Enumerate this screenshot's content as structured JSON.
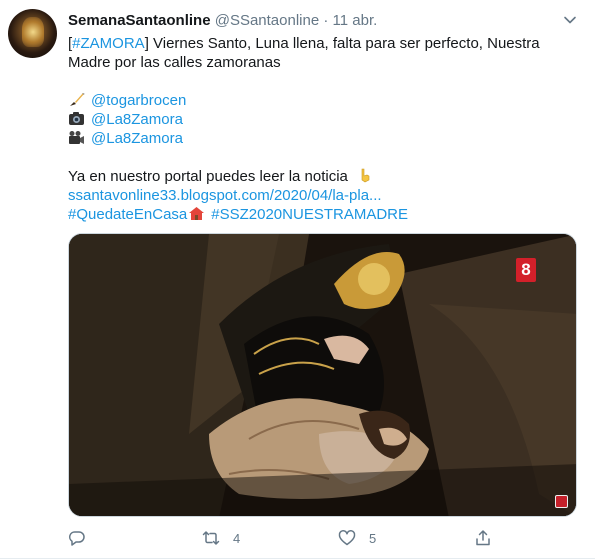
{
  "tweet": {
    "display_name": "SemanaSantaonline",
    "handle": "@SSantaonline",
    "separator": "·",
    "date": "11 abr.",
    "text_line1": "[#ZAMORA]  Viernes Santo, Luna llena, falta para ser perfecto, Nuestra",
    "text_line2": "Madre por las calles zamoranas",
    "credit1": "@togarbrocen",
    "credit2": "@La8Zamora",
    "credit3": "@La8Zamora",
    "portal_text": "Ya en nuestro portal puedes leer la noticia",
    "url": "ssantavonline33.blogspot.com/2020/04/la-pla...",
    "hashtag1": "#QuedateEnCasa",
    "hashtag2": "#SSZ2020NUESTRAMADRE",
    "media_badge": "8"
  },
  "actions": {
    "reply_count": "",
    "retweet_count": "4",
    "like_count": "5"
  },
  "icons": [
    "chevron-down-icon",
    "paintbrush-icon",
    "camera-icon",
    "video-camera-icon",
    "pointing-down-icon",
    "house-icon",
    "reply-icon",
    "retweet-icon",
    "like-icon",
    "share-icon"
  ],
  "colors": {
    "link": "#1b95e0",
    "secondary": "#657786",
    "badge": "#d3202a"
  }
}
